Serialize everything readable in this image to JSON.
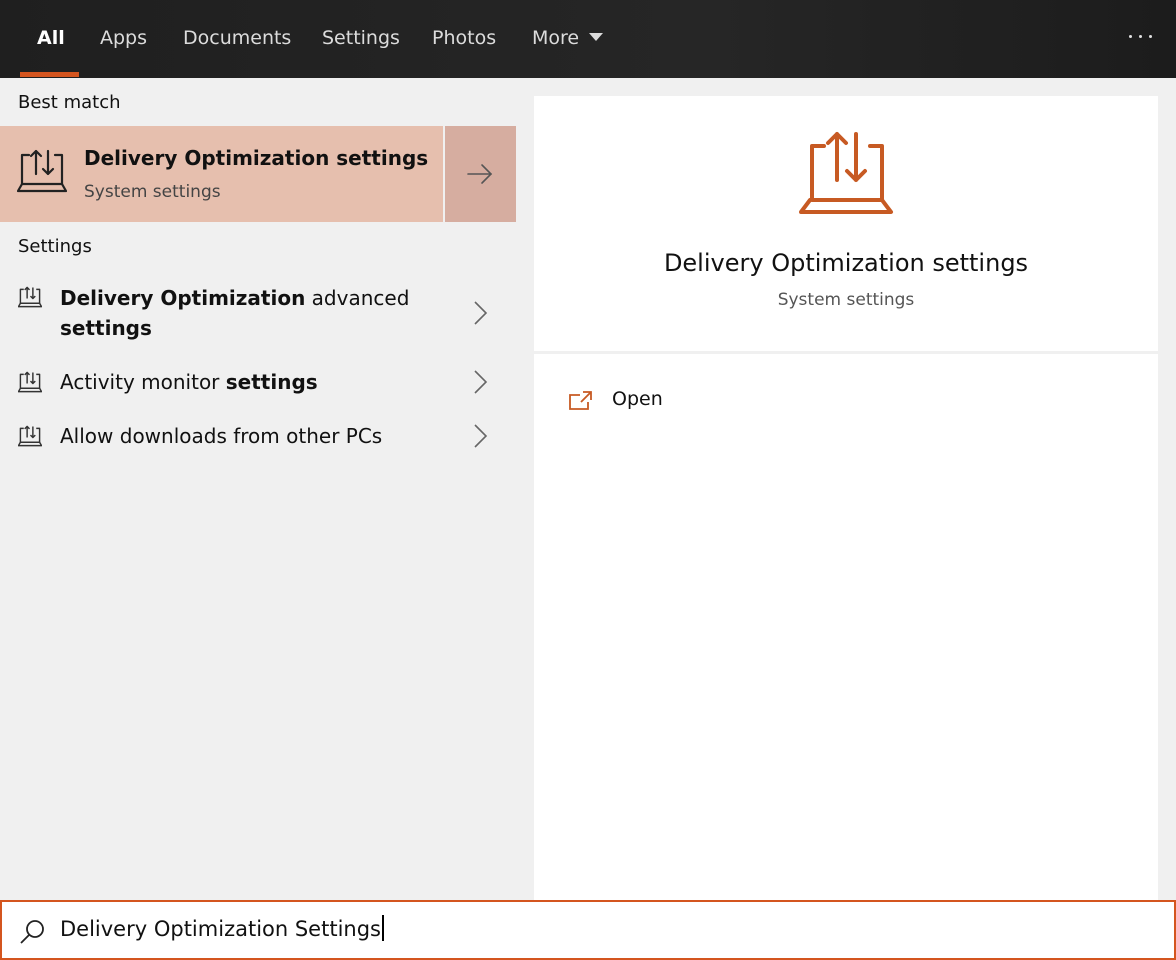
{
  "tabs": [
    {
      "label": "All",
      "active": true
    },
    {
      "label": "Apps"
    },
    {
      "label": "Documents"
    },
    {
      "label": "Settings"
    },
    {
      "label": "Photos"
    },
    {
      "label": "More"
    }
  ],
  "overflow_icon": "ellipsis-icon",
  "best_match": {
    "heading": "Best match",
    "title": "Delivery Optimization settings",
    "subtitle": "System settings",
    "icon": "delivery-optimization-icon"
  },
  "settings_section": {
    "heading": "Settings",
    "items": [
      {
        "bold1": "Delivery Optimization",
        "normal1": " advanced",
        "bold2": "settings"
      },
      {
        "normal1": "Activity monitor ",
        "bold1": "settings"
      },
      {
        "normal1": "Allow downloads from other PCs"
      }
    ]
  },
  "preview": {
    "title": "Delivery Optimization settings",
    "subtitle": "System settings",
    "actions": [
      {
        "label": "Open",
        "icon": "open-external-icon"
      }
    ]
  },
  "search": {
    "value": "Delivery Optimization Settings",
    "icon": "search-icon"
  },
  "colors": {
    "accent": "#d4551f",
    "best_match_bg": "#e6bfae"
  }
}
